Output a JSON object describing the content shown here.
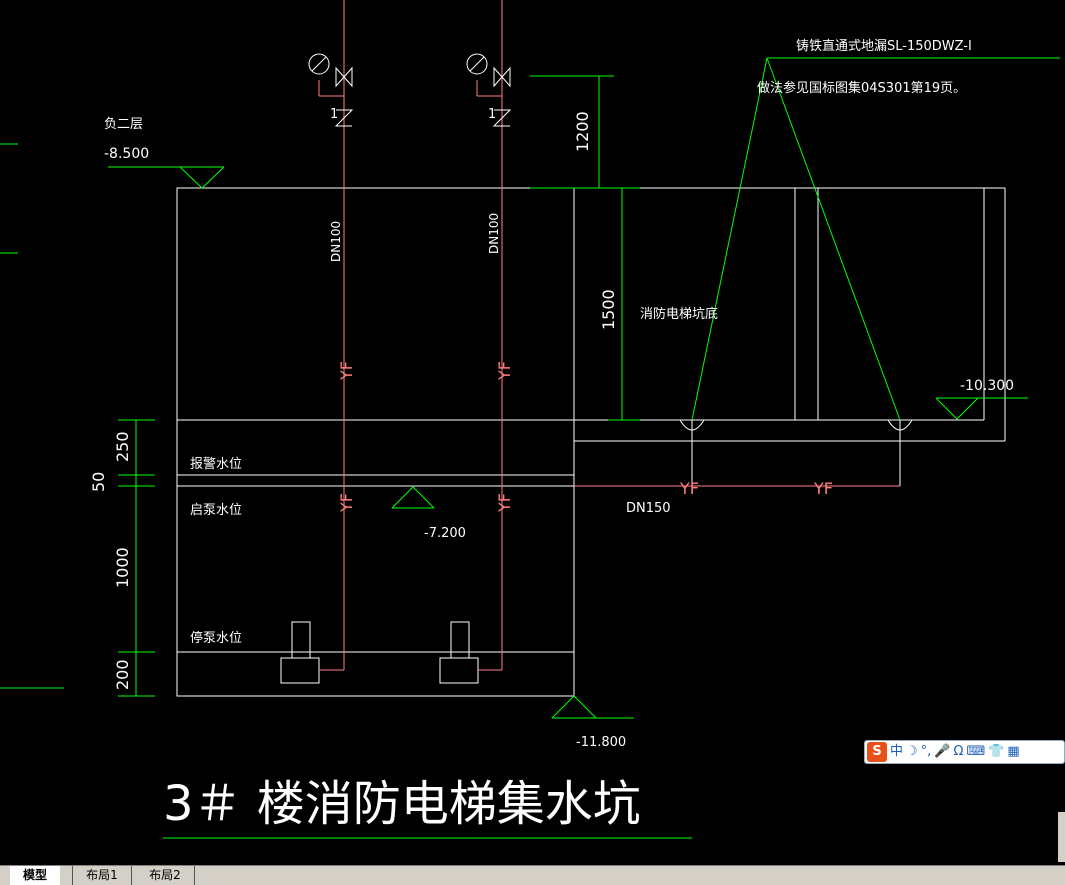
{
  "drawing": {
    "title": "3＃ 楼消防电梯集水坑",
    "floor_label": "负二层",
    "floor_elev": "-8.500",
    "note_line1": "铸铁直通式地漏SL-150DWZ-I",
    "note_line2": "做法参见国标图集04S301第19页。",
    "pit_label": "消防电梯坑底",
    "pit_elev": "-10.300",
    "start_pump_elev": "-7.200",
    "bottom_elev": "-11.800",
    "alarm_level": "报警水位",
    "start_level": "启泵水位",
    "stop_level": "停泵水位",
    "pipe_size_left": "DN100",
    "pipe_size_right": "DN100",
    "drain_size": "DN150",
    "pipe_code": "YF",
    "valve_number": "1",
    "dims": {
      "d1200": "1200",
      "d1500": "1500",
      "d250": "250",
      "d50": "50",
      "d1000": "1000",
      "d200": "200"
    }
  },
  "tabs": [
    "模型",
    "布局1",
    "布局2"
  ],
  "ime": {
    "logo": "S",
    "items": [
      "中",
      "☽",
      "°,",
      "🎤",
      "Ω",
      "⌨",
      "👕",
      "▦"
    ]
  },
  "colors": {
    "background": "#000000",
    "structure": "#ffffff",
    "dimension": "#00ff00",
    "pipe": "#ff7f7f",
    "tab_bar": "#d4d0c8"
  }
}
